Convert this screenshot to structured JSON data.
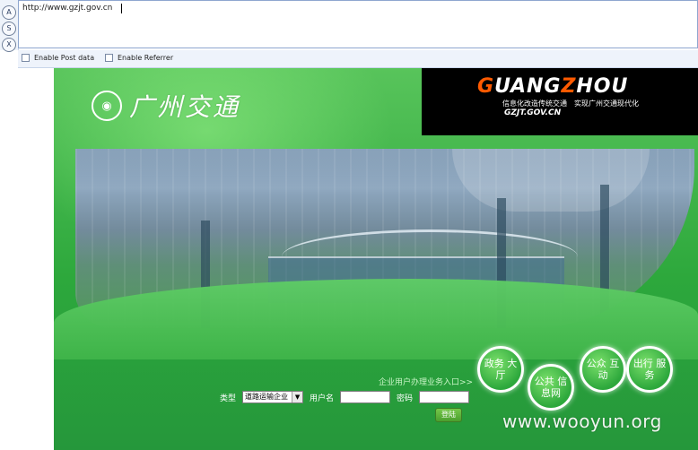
{
  "hackbar": {
    "buttons": [
      "A",
      "S",
      "X"
    ],
    "url_value": "http://www.gzjt.gov.cn",
    "options": [
      {
        "label": "Enable Post data",
        "checked": false
      },
      {
        "label": "Enable Referrer",
        "checked": false
      }
    ]
  },
  "site": {
    "logo_text": "广州交通",
    "brand": {
      "left": "G",
      "middle": "UANG",
      "z": "Z",
      "right": "HOU"
    },
    "slogan": "信息化改造传统交通　实现广州交通现代化",
    "domain": "GZJT.GOV.CN",
    "entrance_link": "企业用户办理业务入口>>",
    "login": {
      "type_label": "类型",
      "type_selected": "道路运输企业",
      "username_label": "用户名",
      "password_label": "密码",
      "submit_label": "登陆"
    },
    "circles": [
      {
        "label": "政务 大厅"
      },
      {
        "label": "公共 信息网"
      },
      {
        "label": "公众 互动"
      },
      {
        "label": "出行 服务"
      }
    ]
  },
  "watermark": "www.wooyun.org",
  "colors": {
    "brand_orange": "#ff5a00",
    "site_green": "#2da83c",
    "black_panel": "#000000"
  },
  "icons": [
    "address-icon",
    "select-arrow-icon",
    "checkbox-icon"
  ]
}
